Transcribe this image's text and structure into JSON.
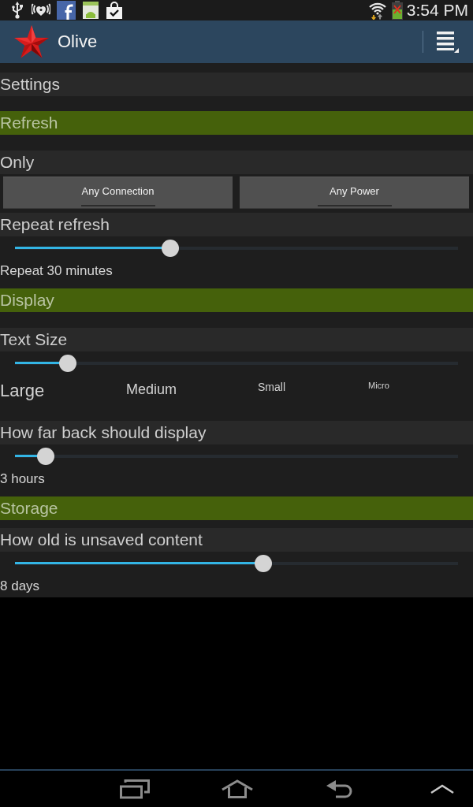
{
  "status_bar": {
    "time": "3:54 PM"
  },
  "action_bar": {
    "title": "Olive"
  },
  "page_title": "Settings",
  "sections": [
    {
      "title": "Refresh",
      "items": [
        {
          "kind": "toggles",
          "label": "Only",
          "buttons": [
            {
              "label": "Any Connection",
              "on": false
            },
            {
              "label": "Any Power",
              "on": false
            }
          ]
        },
        {
          "kind": "slider",
          "label": "Repeat refresh",
          "level": 0.35,
          "reading": "Repeat 30 minutes"
        }
      ]
    },
    {
      "title": "Display",
      "items": [
        {
          "kind": "scale",
          "label": "Text Size",
          "level": 0.12,
          "stops": [
            "Large",
            "Medium",
            "Small",
            "Micro"
          ]
        },
        {
          "kind": "slider",
          "label": "How far back should display",
          "level": 0.07,
          "reading": "3 hours"
        }
      ]
    },
    {
      "title": "Storage",
      "items": [
        {
          "kind": "slider",
          "label": "How old is unsaved content",
          "level": 0.56,
          "reading": "8 days"
        }
      ]
    }
  ]
}
